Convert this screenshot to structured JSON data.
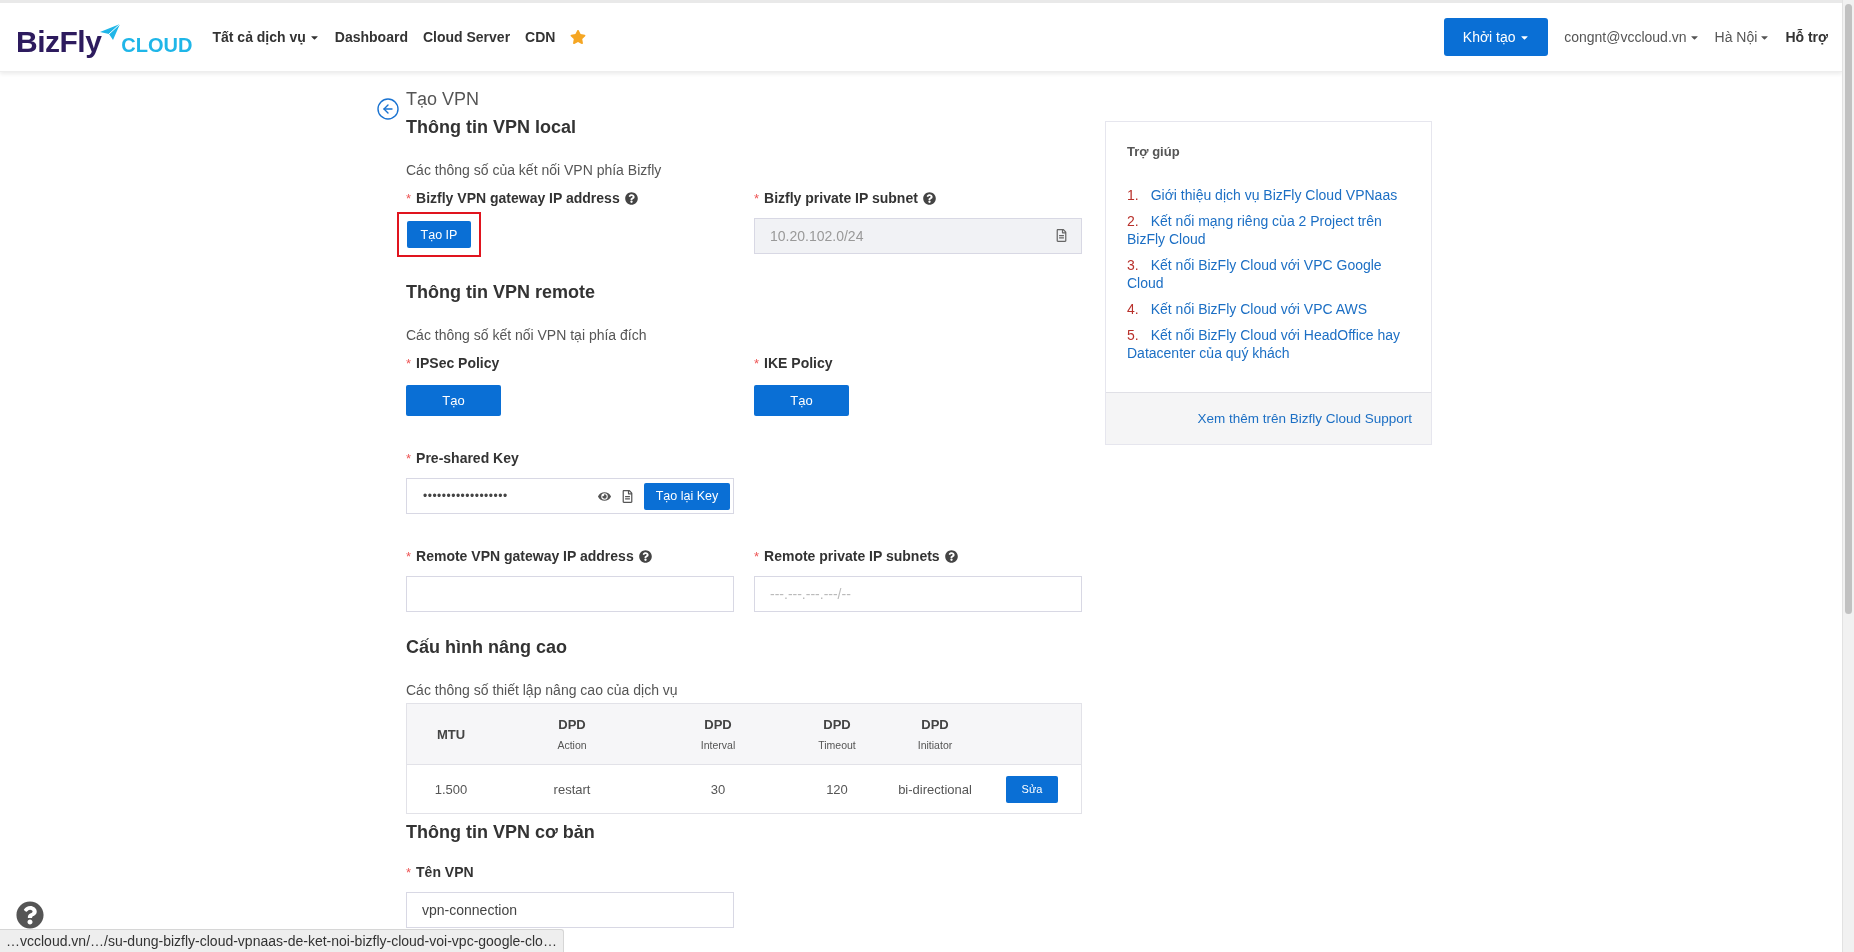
{
  "header": {
    "logo": {
      "brand": "BizFly",
      "sub": "CLOUD"
    },
    "nav": [
      {
        "label": "Tất cả dịch vụ",
        "dropdown": true
      },
      {
        "label": "Dashboard",
        "dropdown": false
      },
      {
        "label": "Cloud Server",
        "dropdown": false
      },
      {
        "label": "CDN",
        "dropdown": false
      }
    ],
    "favorite": true,
    "create_button": {
      "label": "Khởi tạo",
      "dropdown": true
    },
    "account": {
      "label": "congnt@vccloud.vn",
      "dropdown": true
    },
    "region": {
      "label": "Hà Nội",
      "dropdown": true
    },
    "support": "Hỗ trợ"
  },
  "page": {
    "title": "Tạo VPN",
    "sections": [
      {
        "heading": "Thông tin VPN local",
        "description": "Các thông số của kết nối VPN phía Bizfly",
        "rows": [
          [
            {
              "kind": "button",
              "asterisk": "*",
              "label": "Bizfly VPN gateway IP address",
              "help": true,
              "button": "Tạo IP",
              "highlighted": true
            },
            {
              "kind": "input",
              "asterisk": "*",
              "label": "Bizfly private IP subnet",
              "help": true,
              "value": "10.20.102.0/24",
              "disabled": true
            }
          ]
        ]
      },
      {
        "heading": "Thông tin VPN remote",
        "description": "Các thông số kết nối VPN tại phía đích",
        "rows": [
          [
            {
              "kind": "wide-button",
              "asterisk": "*",
              "label": "IPSec Policy",
              "help": false,
              "button": "Tạo"
            },
            {
              "kind": "wide-button",
              "asterisk": "*",
              "label": "IKE Policy",
              "help": false,
              "button": "Tạo"
            }
          ],
          [
            {
              "kind": "secret",
              "asterisk": "*",
              "label": "Pre-shared Key",
              "help": false,
              "value": "••••••••••••••••••",
              "button": "Tạo lại Key"
            }
          ],
          [
            {
              "kind": "input",
              "asterisk": "*",
              "label": "Remote VPN gateway IP address",
              "help": true,
              "disabled": false
            },
            {
              "kind": "input",
              "asterisk": "*",
              "label": "Remote private IP subnets",
              "help": true,
              "placeholder": "---.---.---.---/--",
              "disabled": false
            }
          ]
        ]
      },
      {
        "heading": "Cấu hình nâng cao",
        "description": "Các thông số thiết lập nâng cao của dịch vụ",
        "table": {
          "columns": [
            {
              "title": "MTU"
            },
            {
              "title": "DPD",
              "subtitle": "Action"
            },
            {
              "title": "DPD",
              "subtitle": "Interval"
            },
            {
              "title": "DPD",
              "subtitle": "Timeout"
            },
            {
              "title": "DPD",
              "subtitle": "Initiator"
            }
          ],
          "rows": [
            {
              "cells": [
                "1.500",
                "restart",
                "30",
                "120",
                "bi-directional"
              ],
              "action": "Sửa"
            }
          ]
        }
      },
      {
        "heading": "Thông tin VPN cơ bản",
        "rows": [
          [
            {
              "kind": "input",
              "asterisk": "*",
              "label": "Tên VPN",
              "help": false,
              "value": "vpn-connection",
              "disabled": false
            }
          ]
        ]
      }
    ]
  },
  "help_panel": {
    "title": "Trợ giúp",
    "items": [
      {
        "number": "1.",
        "text": "Giới thiệu dịch vụ BizFly Cloud VPNaas"
      },
      {
        "number": "2.",
        "text": "Kết nối mạng riêng của 2 Project trên BizFly Cloud"
      },
      {
        "number": "3.",
        "text": "Kết nối BizFly Cloud với VPC Google Cloud"
      },
      {
        "number": "4.",
        "text": "Kết nối BizFly Cloud với VPC AWS"
      },
      {
        "number": "5.",
        "text": "Kết nối BizFly Cloud với HeadOffice hay Datacenter của quý khách"
      }
    ],
    "footer_link": "Xem thêm trên Bizfly Cloud Support"
  },
  "status_url": "…vccloud.vn/…/su-dung-bizfly-cloud-vpnaas-de-ket-noi-bizfly-cloud-voi-vpc-google-clo…"
}
